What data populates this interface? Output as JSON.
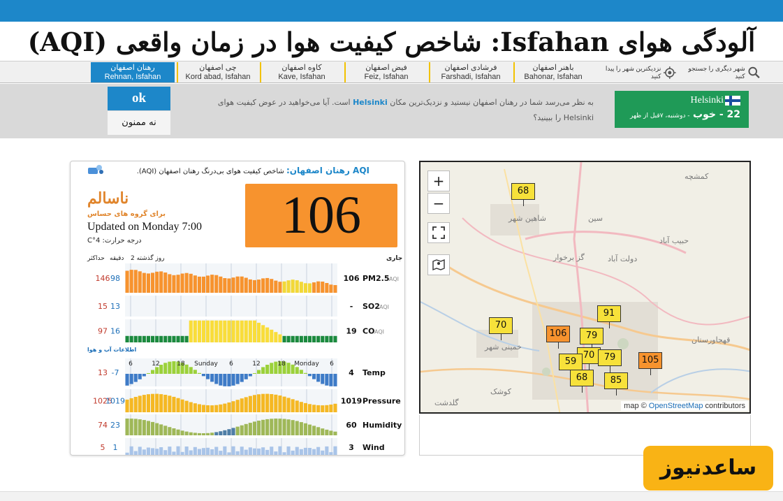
{
  "page": {
    "title": "آلودگی هوای Isfahan: شاخص کیفیت هوا در زمان واقعی (AQI)"
  },
  "nav": {
    "items": [
      {
        "fa": "رهنان اصفهان",
        "en": "Rehnan, Isfahan",
        "active": true
      },
      {
        "fa": "چی اصفهان",
        "en": "Kord abad, Isfahan"
      },
      {
        "fa": "کاوه اصفهان",
        "en": "Kave, Isfahan"
      },
      {
        "fa": "فیض اصفهان",
        "en": "Feiz, Isfahan"
      },
      {
        "fa": "فرشادی اصفهان",
        "en": "Farshadi, Isfahan"
      },
      {
        "fa": "باهنر اصفهان",
        "en": "Bahonar, Isfahan"
      }
    ],
    "nearest_label": "نزدیکترین شهر را پیدا کنید",
    "search_label": "شهر دیگری را جستجو کنید"
  },
  "banner": {
    "ok": "ok",
    "no": "نه ممنون",
    "text_before": "به نظر می‌رسد شما در رهنان اصفهان نیستید و نزدیک‌ترین مکان",
    "city": "Helsinki",
    "text_mid": "است. آیا می‌خواهید در عوض کیفیت هوای",
    "text_end": "Helsinki را ببینید؟",
    "sugg_city": "Helsinki",
    "sugg_aqi": "22 - خوب",
    "sugg_time": "- دوشنبه، ۷قبل از ظهر"
  },
  "panel": {
    "aqi_link": "AQI رهنان اصفهان:",
    "head_text": "شاخص کیفیت هوای بی‌درنگ رهنان اصفهان (AQI).",
    "aqi": "106",
    "level": "ناسالم",
    "level_sub": "برای گروه های حساس",
    "updated": "Updated on Monday 7:00",
    "temp": "درجه حرارت: 4°C",
    "col_current": "جاری",
    "col_history": "2 روز گذشته",
    "col_min": "دقیقه",
    "col_max": "حداکثر",
    "weather_info": "اطلاعات آب و هوا",
    "ticks": [
      "6",
      "12",
      "18",
      "Sunday",
      "6",
      "12",
      "18",
      "Monday",
      "6"
    ],
    "rows": [
      {
        "name": "PM2.5",
        "unit": "AQI",
        "cur": "106",
        "min": "98",
        "max": "146"
      },
      {
        "name": "SO2",
        "unit": "AQI",
        "cur": "-",
        "min": "13",
        "max": "15"
      },
      {
        "name": "CO",
        "unit": "AQI",
        "cur": "19",
        "min": "16",
        "max": "97"
      },
      {
        "name": "Temp",
        "unit": "",
        "cur": "4",
        "min": "-7",
        "max": "13"
      },
      {
        "name": "Pressure",
        "unit": "",
        "cur": "1019",
        "min": "1019",
        "max": "1025"
      },
      {
        "name": "Humidity",
        "unit": "",
        "cur": "60",
        "min": "23",
        "max": "74"
      },
      {
        "name": "Wind",
        "unit": "",
        "cur": "3",
        "min": "1",
        "max": "5"
      }
    ]
  },
  "map": {
    "zoom_in": "+",
    "zoom_out": "−",
    "attribution_pre": "map ©",
    "attribution_osm": "OpenStreetMap",
    "attribution_post": "contributors",
    "places": [
      "کمشچه",
      "شاهین شهر",
      "سین",
      "حبیب آباد",
      "گز برخوار",
      "دولت آباد",
      "خمینی شهر",
      "قهجاورستان",
      "کوشک",
      "گلدشت"
    ],
    "markers": [
      {
        "value": "68",
        "color": "#f7e13a"
      },
      {
        "value": "91",
        "color": "#f7e13a"
      },
      {
        "value": "70",
        "color": "#f7e13a"
      },
      {
        "value": "106",
        "color": "#f7932e"
      },
      {
        "value": "79",
        "color": "#f7e13a"
      },
      {
        "value": "70",
        "color": "#f7e13a"
      },
      {
        "value": "79",
        "color": "#f7e13a"
      },
      {
        "value": "59",
        "color": "#f7e13a"
      },
      {
        "value": "68",
        "color": "#f7e13a"
      },
      {
        "value": "85",
        "color": "#f7e13a"
      },
      {
        "value": "105",
        "color": "#f7932e"
      }
    ]
  },
  "watermark": "ساعدنیوز"
}
